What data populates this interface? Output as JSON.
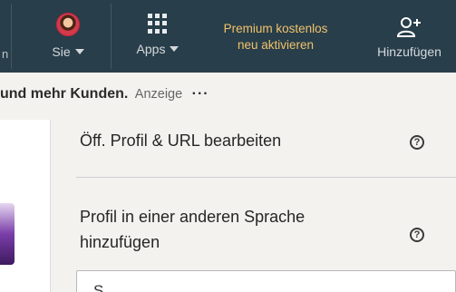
{
  "nav": {
    "truncated_prev_label": "n",
    "me_label": "Sie",
    "apps_label": "Apps",
    "premium_line1": "Premium kostenlos",
    "premium_line2": "neu aktivieren",
    "add_label": "Hinzufügen"
  },
  "ad": {
    "text": "und mehr Kunden.",
    "anzeige": "Anzeige",
    "more": "···"
  },
  "panel": {
    "edit_profile_url": "Öff. Profil & URL bearbeiten",
    "add_language_profile": "Profil in einer anderen Sprache hinzufügen",
    "help_glyph": "?",
    "input_partial": "S"
  },
  "colors": {
    "nav_bg": "#283e4a",
    "premium_text": "#f1c36b",
    "page_bg": "#f3f2ef"
  }
}
